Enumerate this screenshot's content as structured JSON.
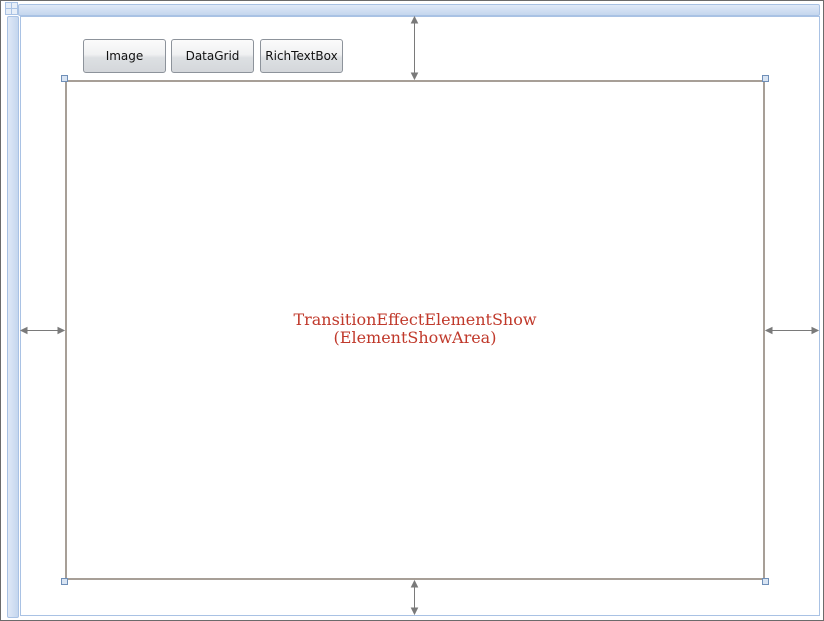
{
  "toolbar": {
    "buttons": [
      {
        "label": "Image"
      },
      {
        "label": "DataGrid"
      },
      {
        "label": "RichTextBox"
      }
    ]
  },
  "show_area": {
    "title_line1": "TransitionEffectElementShow",
    "title_line2": "(ElementShowArea)",
    "label_color": "#c0392b",
    "border_color": "#a79f97"
  },
  "designer": {
    "ruler_color": "#c4d6ee",
    "guide_color": "#7a7a7a"
  }
}
